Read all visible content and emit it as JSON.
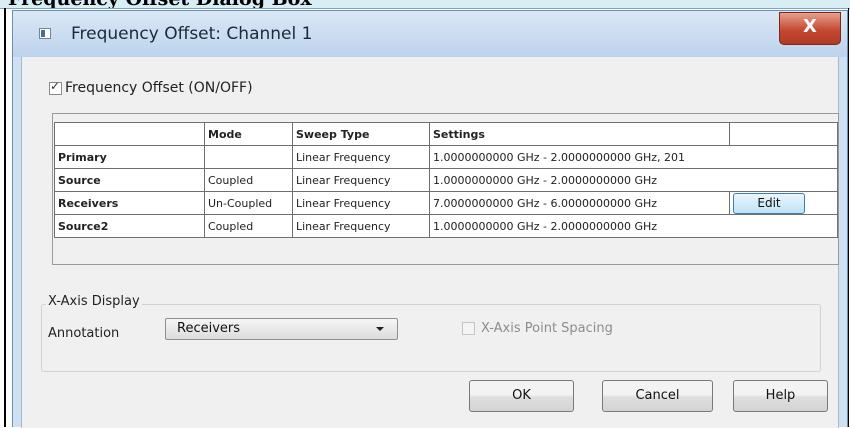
{
  "banner": {
    "text": "Frequency Offset Dialog Box"
  },
  "dialog": {
    "title": "Frequency Offset: Channel 1",
    "close_symbol": "X"
  },
  "offset_toggle": {
    "label": "Frequency Offset (ON/OFF)",
    "checked": true
  },
  "grid": {
    "headers": [
      "",
      "Mode",
      "Sweep Type",
      "Settings",
      ""
    ],
    "rows": [
      {
        "name": "Primary",
        "mode": "",
        "sweep_type": "Linear Frequency",
        "settings": "1.0000000000 GHz - 2.0000000000 GHz, 201"
      },
      {
        "name": "Source",
        "mode": "Coupled",
        "sweep_type": "Linear Frequency",
        "settings": "1.0000000000 GHz - 2.0000000000 GHz"
      },
      {
        "name": "Receivers",
        "mode": "Un-Coupled",
        "sweep_type": "Linear Frequency",
        "settings": "7.0000000000 GHz - 6.0000000000 GHz",
        "edit_label": "Edit"
      },
      {
        "name": "Source2",
        "mode": "Coupled",
        "sweep_type": "Linear Frequency",
        "settings": "1.0000000000 GHz - 2.0000000000 GHz"
      }
    ]
  },
  "x_axis_display": {
    "group_title": "X-Axis Display",
    "annotation_label": "Annotation",
    "annotation_value": "Receivers",
    "point_spacing_label": "X-Axis Point Spacing",
    "point_spacing_checked": false
  },
  "buttons": {
    "ok": "OK",
    "cancel": "Cancel",
    "help": "Help"
  },
  "colors": {
    "title_bar": "#c9dbef",
    "close_button": "#c54932",
    "client_bg": "#f0f0f0"
  }
}
